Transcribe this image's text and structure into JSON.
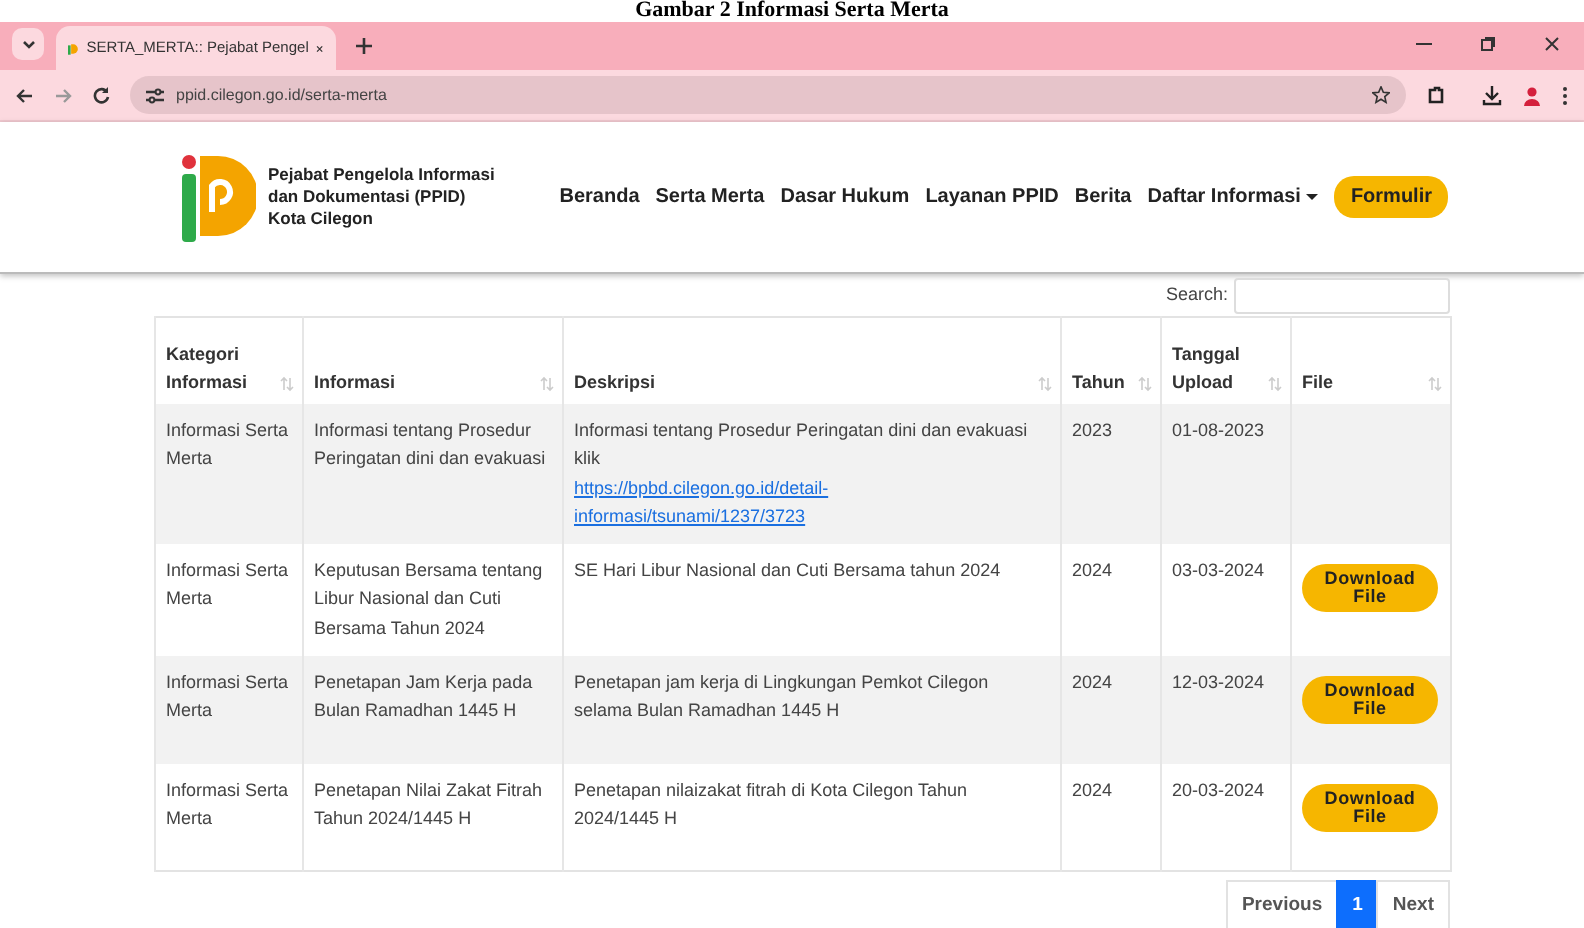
{
  "caption": "Gambar 2 Informasi Serta Merta",
  "browser": {
    "tab_title": "SERTA_MERTA:: Pejabat Pengel",
    "url": "ppid.cilegon.go.id/serta-merta"
  },
  "site": {
    "name_lines": [
      "Pejabat Pengelola Informasi",
      "dan Dokumentasi (PPID)",
      "Kota Cilegon"
    ]
  },
  "nav": [
    {
      "label": "Beranda",
      "kind": "link"
    },
    {
      "label": "Serta Merta",
      "kind": "link"
    },
    {
      "label": "Dasar Hukum",
      "kind": "link"
    },
    {
      "label": "Layanan PPID",
      "kind": "link"
    },
    {
      "label": "Berita",
      "kind": "link"
    },
    {
      "label": "Daftar Informasi",
      "kind": "dropdown"
    },
    {
      "label": "Formulir",
      "kind": "button"
    }
  ],
  "search": {
    "label": "Search:"
  },
  "table": {
    "columns": [
      {
        "label": "Kategori Informasi"
      },
      {
        "label": "Informasi"
      },
      {
        "label": "Deskripsi"
      },
      {
        "label": "Tahun"
      },
      {
        "label": "Tanggal Upload"
      },
      {
        "label": "File"
      }
    ],
    "rows": [
      {
        "category": "Informasi Serta Merta",
        "information": "Informasi tentang Prosedur Peringatan dini dan evakuasi",
        "description": "Informasi tentang Prosedur Peringatan dini dan evakuasi klik",
        "link": "https://bpbd.cilegon.go.id/detail-informasi/tsunami/1237/3723",
        "year": "2023",
        "date": "01-08-2023"
      },
      {
        "category": "Informasi Serta Merta",
        "information": "Keputusan Bersama tentang Libur Nasional dan Cuti Bersama Tahun 2024",
        "description": "SE Hari Libur Nasional dan Cuti Bersama tahun 2024",
        "year": "2024",
        "date": "03-03-2024",
        "file_button": "Download File"
      },
      {
        "category": "Informasi Serta Merta",
        "information": "Penetapan Jam Kerja pada Bulan Ramadhan 1445 H",
        "description": "Penetapan jam kerja di Lingkungan Pemkot Cilegon selama Bulan Ramadhan 1445 H",
        "year": "2024",
        "date": "12-03-2024",
        "file_button": "Download File"
      },
      {
        "category": "Informasi Serta Merta",
        "information": "Penetapan Nilai Zakat Fitrah Tahun 2024/1445 H",
        "description": "Penetapan nilaizakat fitrah di Kota Cilegon Tahun 2024/1445 H",
        "year": "2024",
        "date": "20-03-2024",
        "file_button": "Download File"
      }
    ]
  },
  "pagination": {
    "previous": "Previous",
    "pages": [
      {
        "label": "1",
        "selected": true
      }
    ],
    "next": "Next"
  }
}
